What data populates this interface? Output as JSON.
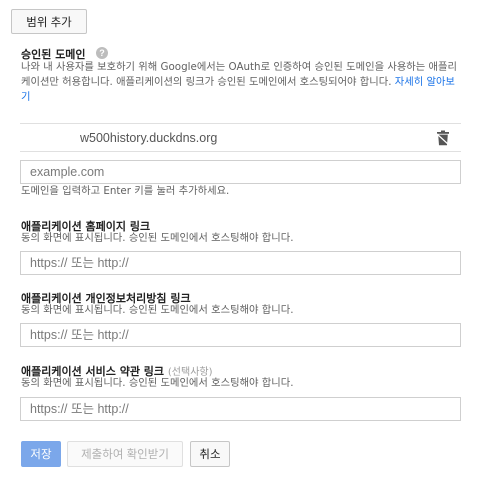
{
  "toolbar": {
    "add_scope_label": "범위 추가"
  },
  "authorized_domains": {
    "heading": "승인된 도메인",
    "help_icon_glyph": "?",
    "description": "나와 내 사용자를 보호하기 위해 Google에서는 OAuth로 인증하여 승인된 도메인을 사용하는 애플리케이션만 허용합니다. 애플리케이션의 링크가 승인된 도메인에서 호스팅되어야 합니다.",
    "learn_more": "자세히 알아보기",
    "domain": "w500history.duckdns.org",
    "input_placeholder": "example.com",
    "hint": "도메인을 입력하고 Enter 키를 눌러 추가하세요."
  },
  "homepage_link": {
    "heading": "애플리케이션 홈페이지 링크",
    "description": "동의 화면에 표시됩니다. 승인된 도메인에서 호스팅해야 합니다.",
    "placeholder": "https:// 또는 http://"
  },
  "privacy_link": {
    "heading": "애플리케이션 개인정보처리방침 링크",
    "description": "동의 화면에 표시됩니다. 승인된 도메인에서 호스팅해야 합니다.",
    "placeholder": "https:// 또는 http://"
  },
  "tos_link": {
    "heading": "애플리케이션 서비스 약관 링크",
    "optional": "(선택사항)",
    "description": "동의 화면에 표시됩니다. 승인된 도메인에서 호스팅해야 합니다.",
    "placeholder": "https:// 또는 http://"
  },
  "actions": {
    "save": "저장",
    "submit_for_verification": "제출하여 확인받기",
    "cancel": "취소"
  },
  "colors": {
    "primary_button": "#7ba7ea",
    "link": "#1a73e8"
  },
  "icons": {
    "help": "help-icon",
    "delete": "trash-icon"
  }
}
